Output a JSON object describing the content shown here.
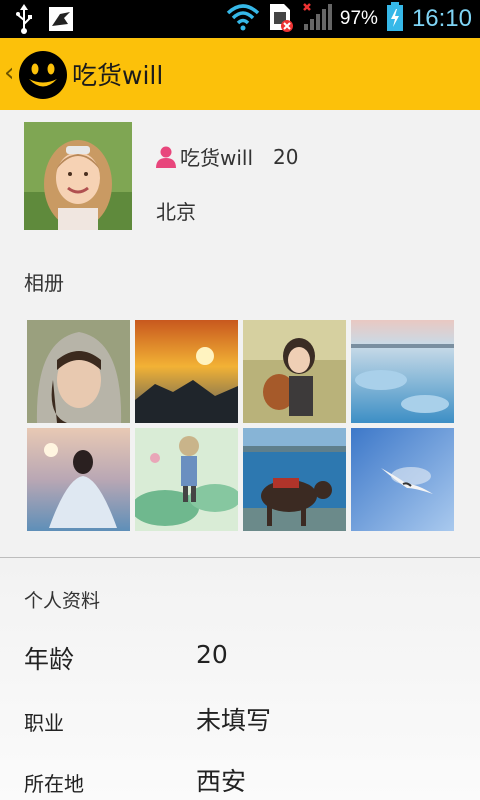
{
  "status_bar": {
    "battery": "97%",
    "time": "16:10",
    "icons": [
      "usb-icon",
      "bird-app-icon",
      "wifi-icon",
      "sim-error-icon",
      "signal-icon",
      "battery-icon"
    ]
  },
  "action_bar": {
    "title": "吃货will",
    "accent_color": "#fcc10a"
  },
  "profile": {
    "name": "吃货will",
    "age": "20",
    "city": "北京"
  },
  "album": {
    "title": "相册",
    "photos": [
      "girl-in-hood",
      "sunset-rocks",
      "girl-with-teddy",
      "frozen-lake",
      "girl-in-white-dress",
      "anime-girl-lotus",
      "yak-at-lake",
      "seagull-sky"
    ]
  },
  "info": {
    "title": "个人资料",
    "rows": [
      {
        "label": "年龄",
        "value": "20"
      },
      {
        "label": "职业",
        "value": "未填写"
      },
      {
        "label": "所在地",
        "value": "西安"
      }
    ]
  }
}
